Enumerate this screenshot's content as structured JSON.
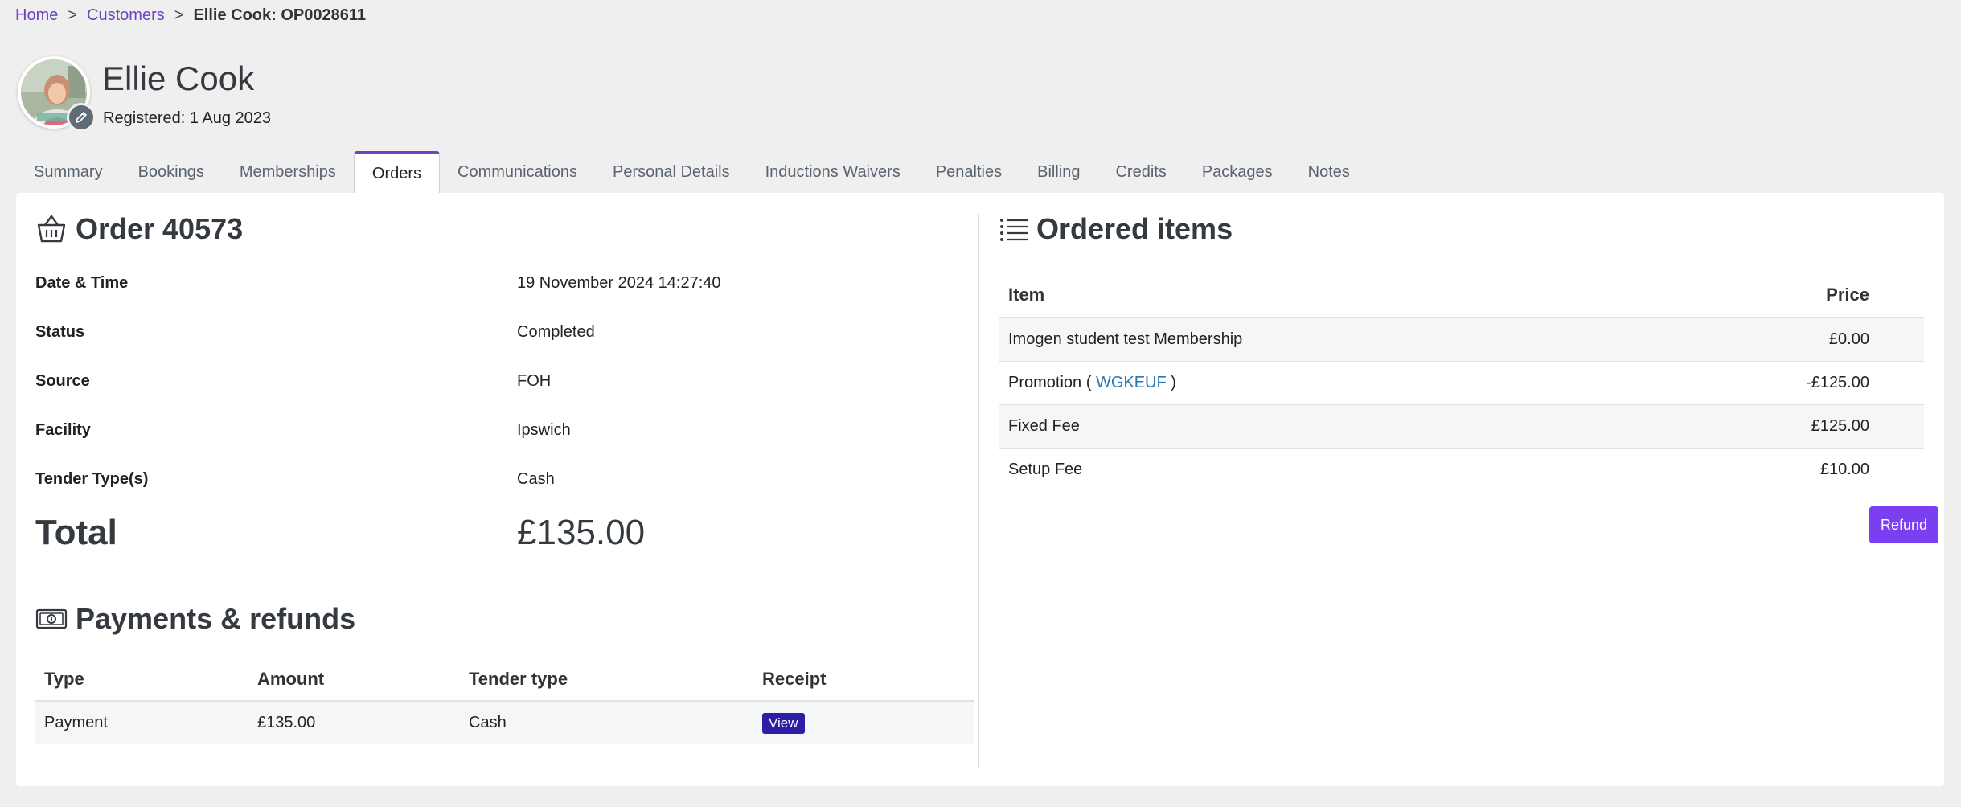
{
  "breadcrumb": {
    "home": "Home",
    "sep1": ">",
    "customers": "Customers",
    "sep2": ">",
    "current": "Ellie Cook: OP0028611"
  },
  "profile": {
    "name": "Ellie Cook",
    "registered": "Registered: 1 Aug 2023"
  },
  "tabs": [
    {
      "label": "Summary"
    },
    {
      "label": "Bookings"
    },
    {
      "label": "Memberships"
    },
    {
      "label": "Orders",
      "active": true
    },
    {
      "label": "Communications"
    },
    {
      "label": "Personal Details"
    },
    {
      "label": "Inductions Waivers"
    },
    {
      "label": "Penalties"
    },
    {
      "label": "Billing"
    },
    {
      "label": "Credits"
    },
    {
      "label": "Packages"
    },
    {
      "label": "Notes"
    }
  ],
  "order": {
    "title": "Order 40573",
    "details": [
      {
        "label": "Date & Time",
        "value": "19 November 2024 14:27:40"
      },
      {
        "label": "Status",
        "value": "Completed"
      },
      {
        "label": "Source",
        "value": "FOH"
      },
      {
        "label": "Facility",
        "value": "Ipswich"
      },
      {
        "label": "Tender Type(s)",
        "value": "Cash"
      }
    ],
    "total_label": "Total",
    "total_value": "£135.00"
  },
  "payments": {
    "title": "Payments & refunds",
    "headers": {
      "type": "Type",
      "amount": "Amount",
      "tender": "Tender type",
      "receipt": "Receipt"
    },
    "rows": [
      {
        "type": "Payment",
        "amount": "£135.00",
        "tender": "Cash",
        "receipt": "View"
      }
    ]
  },
  "ordered_items": {
    "title": "Ordered items",
    "headers": {
      "item": "Item",
      "price": "Price"
    },
    "rows": [
      {
        "item": "Imogen student test Membership",
        "price": "£0.00"
      },
      {
        "item_prefix": "Promotion ( ",
        "item_link": "WGKEUF",
        "item_suffix": " )",
        "price": "-£125.00"
      },
      {
        "item": "Fixed Fee",
        "price": "£125.00"
      },
      {
        "item": "Setup Fee",
        "price": "£10.00"
      }
    ],
    "refund_label": "Refund"
  },
  "colors": {
    "accent": "#6f42c1",
    "refund_button": "#7b3ff2",
    "view_button": "#2d1fa5",
    "link": "#2a78b0"
  }
}
